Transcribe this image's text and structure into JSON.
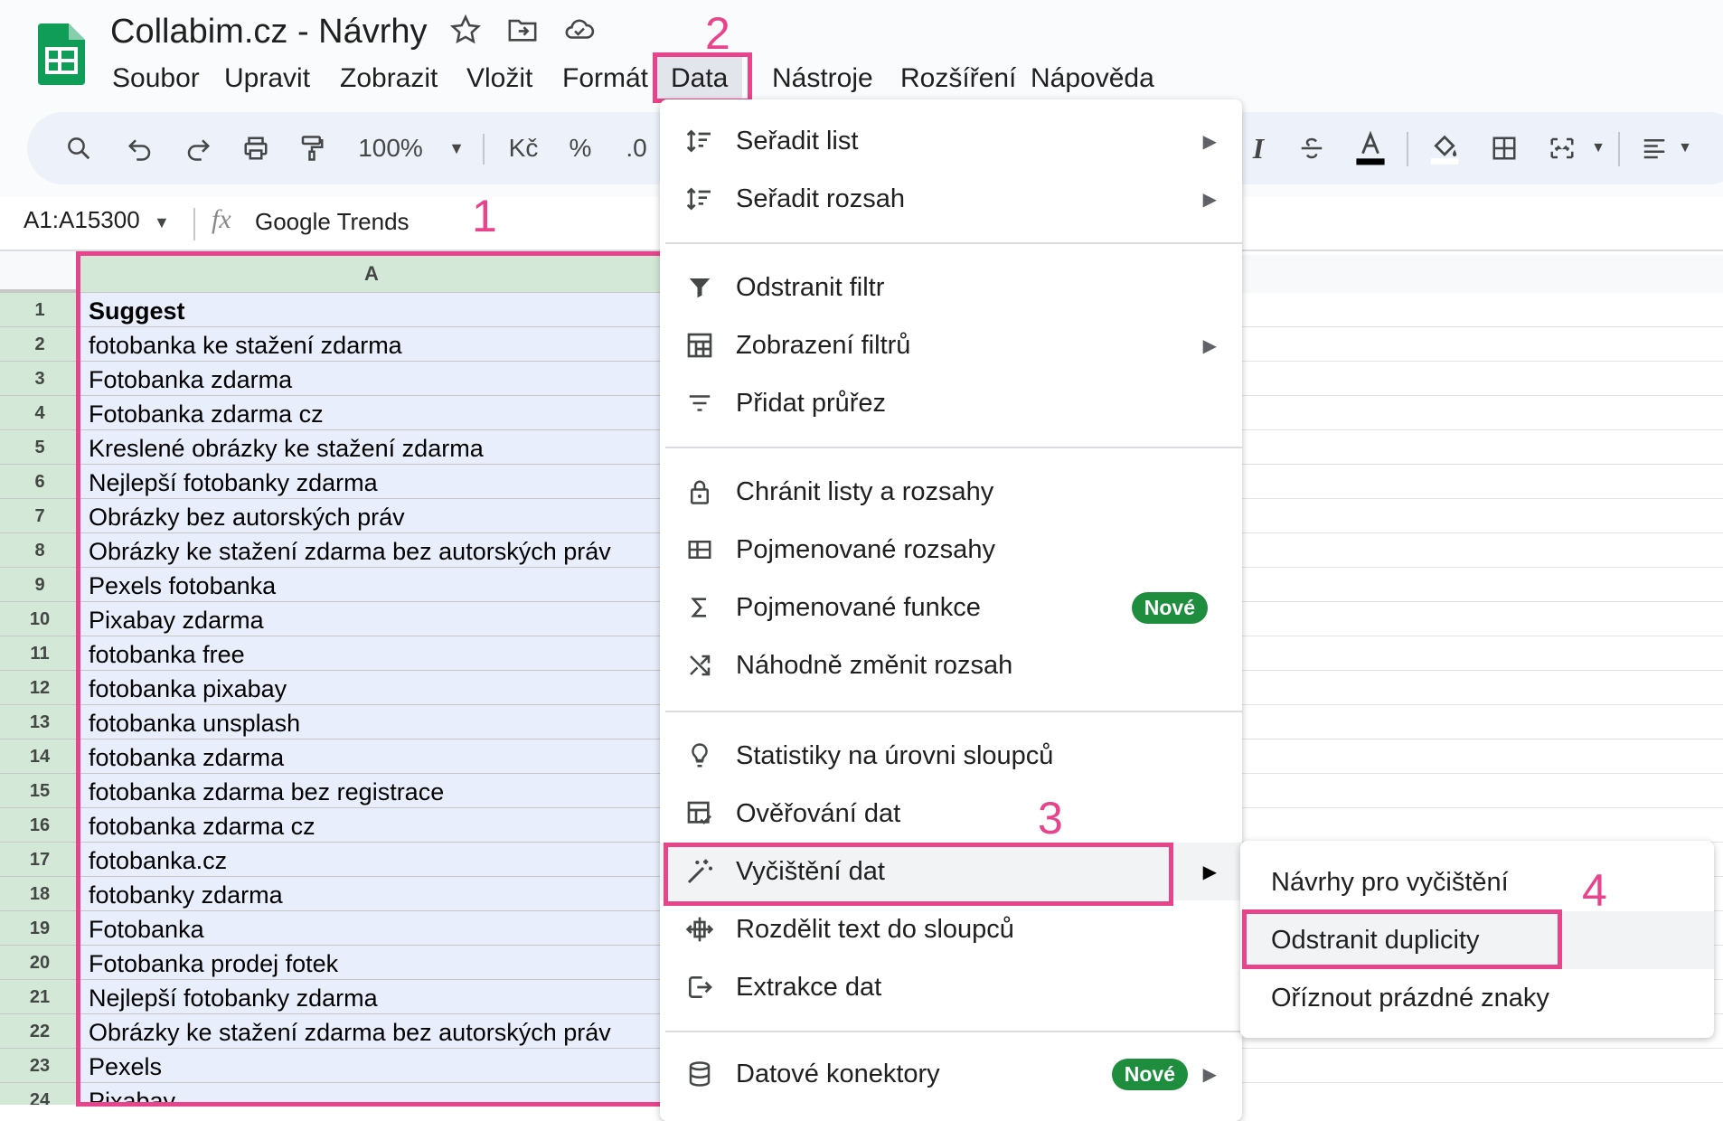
{
  "window": {
    "title": "Collabim.cz - Návrhy"
  },
  "menubar": {
    "items": [
      "Soubor",
      "Upravit",
      "Zobrazit",
      "Vložit",
      "Formát",
      "Data",
      "Nástroje",
      "Rozšíření",
      "Nápověda"
    ]
  },
  "toolbar": {
    "zoom": "100%",
    "currency": "Kč",
    "percent": "%",
    "decimal": ".0"
  },
  "formula_bar": {
    "range": "A1:A15300",
    "fx": "fx",
    "value": "Google Trends"
  },
  "sheet": {
    "column_header": "A",
    "rows": [
      {
        "num": "1",
        "value": "Suggest"
      },
      {
        "num": "2",
        "value": "fotobanka ke stažení zdarma"
      },
      {
        "num": "3",
        "value": "Fotobanka zdarma"
      },
      {
        "num": "4",
        "value": "Fotobanka zdarma cz"
      },
      {
        "num": "5",
        "value": "Kreslené obrázky ke stažení zdarma"
      },
      {
        "num": "6",
        "value": "Nejlepší fotobanky zdarma"
      },
      {
        "num": "7",
        "value": "Obrázky bez autorských práv"
      },
      {
        "num": "8",
        "value": "Obrázky ke stažení zdarma bez autorských práv"
      },
      {
        "num": "9",
        "value": "Pexels fotobanka"
      },
      {
        "num": "10",
        "value": "Pixabay zdarma"
      },
      {
        "num": "11",
        "value": "fotobanka free"
      },
      {
        "num": "12",
        "value": "fotobanka pixabay"
      },
      {
        "num": "13",
        "value": "fotobanka unsplash"
      },
      {
        "num": "14",
        "value": "fotobanka zdarma"
      },
      {
        "num": "15",
        "value": "fotobanka zdarma bez registrace"
      },
      {
        "num": "16",
        "value": "fotobanka zdarma cz"
      },
      {
        "num": "17",
        "value": "fotobanka.cz"
      },
      {
        "num": "18",
        "value": "fotobanky zdarma"
      },
      {
        "num": "19",
        "value": "Fotobanka"
      },
      {
        "num": "20",
        "value": "Fotobanka prodej fotek"
      },
      {
        "num": "21",
        "value": "Nejlepší fotobanky zdarma"
      },
      {
        "num": "22",
        "value": "Obrázky ke stažení zdarma bez autorských práv"
      },
      {
        "num": "23",
        "value": "Pexels"
      },
      {
        "num": "24",
        "value": "Pixabay"
      }
    ]
  },
  "data_menu": {
    "items": [
      {
        "label": "Seřadit list",
        "icon": "sort-icon",
        "submenu": true
      },
      {
        "label": "Seřadit rozsah",
        "icon": "sort-range-icon",
        "submenu": true
      },
      {
        "label": "Odstranit filtr",
        "icon": "filter-icon"
      },
      {
        "label": "Zobrazení filtrů",
        "icon": "filter-views-icon",
        "submenu": true
      },
      {
        "label": "Přidat průřez",
        "icon": "slicer-icon"
      },
      {
        "label": "Chránit listy a rozsahy",
        "icon": "lock-icon"
      },
      {
        "label": "Pojmenované rozsahy",
        "icon": "named-ranges-icon"
      },
      {
        "label": "Pojmenované funkce",
        "icon": "sigma-icon",
        "badge": "Nové"
      },
      {
        "label": "Náhodně změnit rozsah",
        "icon": "shuffle-icon"
      },
      {
        "label": "Statistiky na úrovni sloupců",
        "icon": "lightbulb-icon"
      },
      {
        "label": "Ověřování dat",
        "icon": "data-validation-icon"
      },
      {
        "label": "Vyčištění dat",
        "icon": "magic-wand-icon",
        "submenu": true
      },
      {
        "label": "Rozdělit text do sloupců",
        "icon": "split-icon"
      },
      {
        "label": "Extrakce dat",
        "icon": "extract-icon"
      },
      {
        "label": "Datové konektory",
        "icon": "database-icon",
        "badge": "Nové",
        "submenu": true
      }
    ]
  },
  "cleanup_submenu": {
    "items": [
      "Návrhy pro vyčištění",
      "Odstranit duplicity",
      "Oříznout prázdné znaky"
    ]
  },
  "annotations": [
    "1",
    "2",
    "3",
    "4"
  ],
  "colors": {
    "highlight": "#e8448b",
    "selected_header": "#d3e8d6",
    "selected_cell": "#e8eefb",
    "badge": "#1e8e3e",
    "sheets_green": "#0f9d58"
  }
}
